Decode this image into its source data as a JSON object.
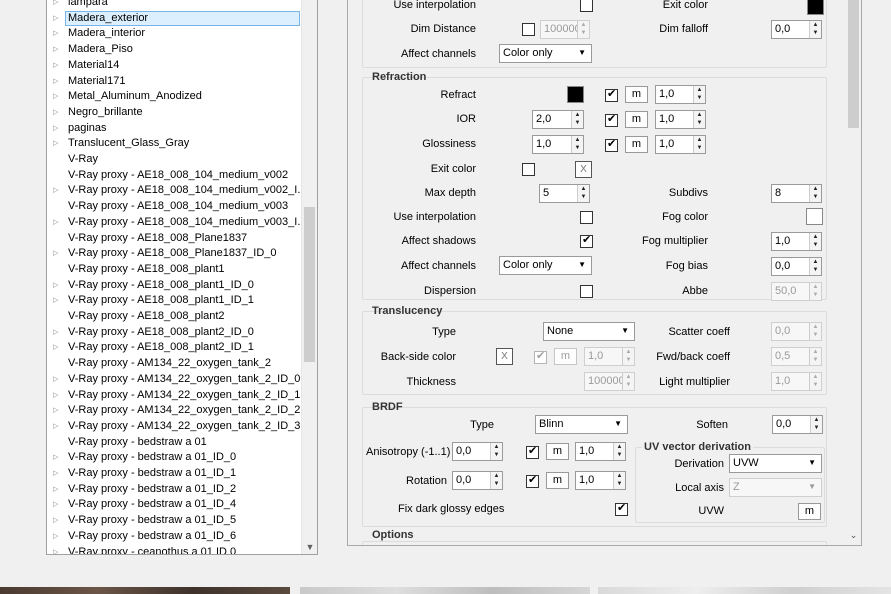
{
  "tree": {
    "items": [
      {
        "label": "lampara",
        "arrow": true
      },
      {
        "label": "Madera_exterior",
        "arrow": true,
        "selected": true
      },
      {
        "label": "Madera_interior",
        "arrow": true
      },
      {
        "label": "Madera_Piso",
        "arrow": true
      },
      {
        "label": "Material14",
        "arrow": true
      },
      {
        "label": "Material171",
        "arrow": true
      },
      {
        "label": "Metal_Aluminum_Anodized",
        "arrow": true
      },
      {
        "label": "Negro_brillante",
        "arrow": true
      },
      {
        "label": "paginas",
        "arrow": true
      },
      {
        "label": "Translucent_Glass_Gray",
        "arrow": true
      },
      {
        "label": "V-Ray",
        "arrow": false
      },
      {
        "label": "V-Ray proxy - AE18_008_104_medium_v002",
        "arrow": false
      },
      {
        "label": "V-Ray proxy - AE18_008_104_medium_v002_I...",
        "arrow": true
      },
      {
        "label": "V-Ray proxy - AE18_008_104_medium_v003",
        "arrow": false
      },
      {
        "label": "V-Ray proxy - AE18_008_104_medium_v003_I...",
        "arrow": true
      },
      {
        "label": "V-Ray proxy - AE18_008_Plane1837",
        "arrow": false
      },
      {
        "label": "V-Ray proxy - AE18_008_Plane1837_ID_0",
        "arrow": true
      },
      {
        "label": "V-Ray proxy - AE18_008_plant1",
        "arrow": false
      },
      {
        "label": "V-Ray proxy - AE18_008_plant1_ID_0",
        "arrow": true
      },
      {
        "label": "V-Ray proxy - AE18_008_plant1_ID_1",
        "arrow": true
      },
      {
        "label": "V-Ray proxy - AE18_008_plant2",
        "arrow": false
      },
      {
        "label": "V-Ray proxy - AE18_008_plant2_ID_0",
        "arrow": true
      },
      {
        "label": "V-Ray proxy - AE18_008_plant2_ID_1",
        "arrow": true
      },
      {
        "label": "V-Ray proxy - AM134_22_oxygen_tank_2",
        "arrow": false
      },
      {
        "label": "V-Ray proxy - AM134_22_oxygen_tank_2_ID_0",
        "arrow": true
      },
      {
        "label": "V-Ray proxy - AM134_22_oxygen_tank_2_ID_1",
        "arrow": true
      },
      {
        "label": "V-Ray proxy - AM134_22_oxygen_tank_2_ID_2",
        "arrow": true
      },
      {
        "label": "V-Ray proxy - AM134_22_oxygen_tank_2_ID_3",
        "arrow": true
      },
      {
        "label": "V-Ray proxy - bedstraw a 01",
        "arrow": false
      },
      {
        "label": "V-Ray proxy - bedstraw a 01_ID_0",
        "arrow": true
      },
      {
        "label": "V-Ray proxy - bedstraw a 01_ID_1",
        "arrow": true
      },
      {
        "label": "V-Ray proxy - bedstraw a 01_ID_2",
        "arrow": true
      },
      {
        "label": "V-Ray proxy - bedstraw a 01_ID_4",
        "arrow": true
      },
      {
        "label": "V-Ray proxy - bedstraw a 01_ID_5",
        "arrow": true
      },
      {
        "label": "V-Ray proxy - bedstraw a 01_ID_6",
        "arrow": true
      },
      {
        "label": "V-Ray proxy - ceanothus a 01 ID 0",
        "arrow": true
      }
    ]
  },
  "top": {
    "use_interpolation": "Use interpolation",
    "exit_color": "Exit color",
    "dim_distance": "Dim Distance",
    "dim_distance_value": "100000",
    "dim_falloff": "Dim falloff",
    "dim_falloff_value": "0,0",
    "affect_channels": "Affect channels",
    "affect_channels_value": "Color only"
  },
  "refraction": {
    "title": "Refraction",
    "refract": "Refract",
    "ior": "IOR",
    "ior_value": "2,0",
    "glossiness": "Glossiness",
    "glossiness_value": "1,0",
    "m": "m",
    "refract_mult": "1,0",
    "ior_mult": "1,0",
    "gloss_mult": "1,0",
    "exit_color": "Exit color",
    "x": "X",
    "max_depth": "Max depth",
    "max_depth_value": "5",
    "subdivs": "Subdivs",
    "subdivs_value": "8",
    "use_interpolation": "Use interpolation",
    "fog_color": "Fog color",
    "affect_shadows": "Affect shadows",
    "fog_multiplier": "Fog multiplier",
    "fog_multiplier_value": "1,0",
    "affect_channels": "Affect channels",
    "affect_channels_value": "Color only",
    "fog_bias": "Fog bias",
    "fog_bias_value": "0,0",
    "dispersion": "Dispersion",
    "abbe": "Abbe",
    "abbe_value": "50,0"
  },
  "translucency": {
    "title": "Translucency",
    "type": "Type",
    "type_value": "None",
    "scatter_coeff": "Scatter coeff",
    "scatter_coeff_value": "0,0",
    "back_side_color": "Back-side color",
    "x": "X",
    "m": "m",
    "back_mult": "1,0",
    "fwd_back_coeff": "Fwd/back coeff",
    "fwd_back_coeff_value": "0,5",
    "thickness": "Thickness",
    "thickness_value": "100000",
    "light_multiplier": "Light multiplier",
    "light_multiplier_value": "1,0"
  },
  "brdf": {
    "title": "BRDF",
    "type": "Type",
    "type_value": "Blinn",
    "soften": "Soften",
    "soften_value": "0,0",
    "anisotropy": "Anisotropy (-1..1)",
    "anisotropy_value": "0,0",
    "rotation": "Rotation",
    "rotation_value": "0,0",
    "m": "m",
    "aniso_mult": "1,0",
    "rot_mult": "1,0",
    "fix_dark": "Fix dark glossy edges",
    "uv_title": "UV vector derivation",
    "derivation": "Derivation",
    "derivation_value": "UVW",
    "local_axis": "Local axis",
    "local_axis_value": "Z",
    "uvw": "UVW",
    "uvw_m": "m"
  },
  "options": {
    "title": "Options"
  },
  "colors": {
    "selection_bg": "#dbeffe",
    "selection_border": "#78b4e6",
    "refract_swatch": "#000000",
    "exit_swatch": "#000000",
    "fog_swatch": "#ffffff"
  }
}
